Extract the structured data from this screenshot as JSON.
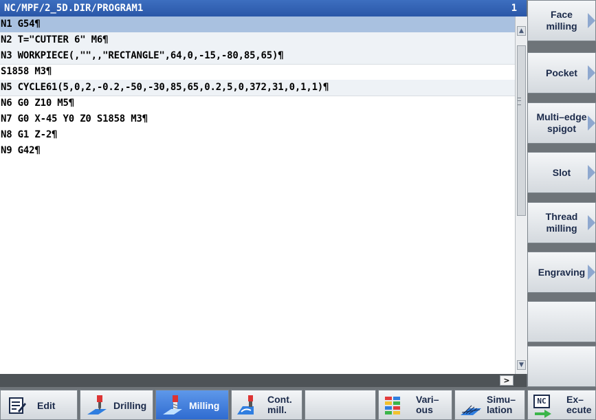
{
  "editor": {
    "title_path": "NC/MPF/2_5D.DIR/PROGRAM1",
    "title_number": "1",
    "lines": [
      "N1 G54¶",
      "N2 T=\"CUTTER 6\" M6¶",
      "N3 WORKPIECE(,\"\",,\"RECTANGLE\",64,0,-15,-80,85,65)¶",
      "S1858 M3¶",
      "N5 CYCLE61(5,0,2,-0.2,-50,-30,85,65,0.2,5,0,372,31,0,1,1)¶",
      "N6 G0 Z10 M5¶",
      "N7 G0 X-45 Y0 Z0 S1858 M3¶",
      "N8 G1 Z-2¶",
      "N9 G42¶"
    ],
    "more_indicator": ">"
  },
  "vertical_softkeys": [
    {
      "label": "Face\nmilling",
      "arrow": true
    },
    {
      "label": "Pocket",
      "arrow": true
    },
    {
      "label": "Multi–edge\nspigot",
      "arrow": true
    },
    {
      "label": "Slot",
      "arrow": true
    },
    {
      "label": "Thread\nmilling",
      "arrow": true
    },
    {
      "label": "Engraving",
      "arrow": true
    },
    {
      "label": "",
      "arrow": false
    },
    {
      "label": "",
      "arrow": false
    }
  ],
  "horizontal_softkeys": {
    "edit": "Edit",
    "drilling": "Drilling",
    "milling": "Milling",
    "cont_mill": "Cont.\nmill.",
    "blank": "",
    "various": "Vari–\nous",
    "simulation": "Simu–\nlation",
    "execute": "Ex–\necute",
    "execute_icon_text": "NC"
  },
  "colors": {
    "title_bar": "#2f5fb3",
    "selected_line": "#a9c1e0",
    "active_softkey": "#3d7ae0",
    "softkey_arrow": "#8ea8cf"
  }
}
